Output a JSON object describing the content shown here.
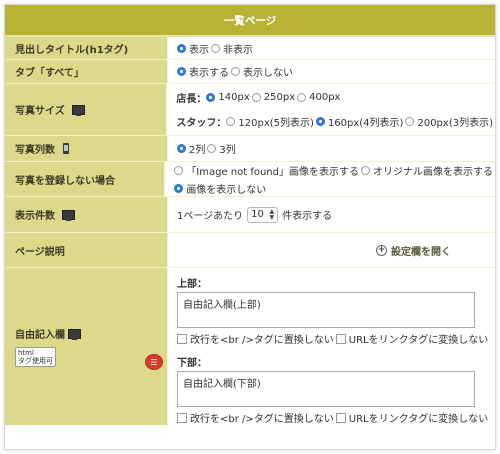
{
  "header": {
    "title": "一覧ページ"
  },
  "rows": {
    "heading_title": {
      "label": "見出しタイトル(h1タグ)",
      "options": [
        "表示",
        "非表示"
      ],
      "selected": "表示"
    },
    "tab_all": {
      "label": "タブ「すべて」",
      "options": [
        "表示する",
        "表示しない"
      ],
      "selected": "表示する"
    },
    "photo_size": {
      "label": "写真サイズ",
      "icon": "monitor-icon",
      "manager_label": "店長：",
      "manager_options": [
        "140px",
        "250px",
        "400px"
      ],
      "manager_selected": "140px",
      "staff_label": "スタッフ：",
      "staff_options": [
        "120px(5列表示)",
        "160px(4列表示)",
        "200px(3列表示)"
      ],
      "staff_selected": "160px(4列表示)"
    },
    "photo_columns": {
      "label": "写真列数",
      "icon": "smartphone-icon",
      "options": [
        "2列",
        "3列"
      ],
      "selected": "2列"
    },
    "no_photo": {
      "label": "写真を登録しない場合",
      "options": [
        "「Image not found」画像を表示する",
        "オリジナル画像を表示する",
        "画像を表示しない"
      ],
      "selected": "画像を表示しない"
    },
    "display_count": {
      "label": "表示件数",
      "icon": "monitor-icon",
      "prefix": "1ページあたり",
      "value": "10",
      "suffix": "件表示する"
    },
    "page_description": {
      "label": "ページ説明",
      "link": "設定欄を開く"
    },
    "free_text": {
      "label": "自由記入欄",
      "icon": "monitor-icon",
      "badge_line1": "html",
      "badge_line2": "タグ使用可",
      "top_label": "上部：",
      "top_value": "自由記入欄(上部)",
      "bottom_label": "下部：",
      "bottom_value": "自由記入欄(下部)",
      "check_br": "改行を<br />タグに置換しない",
      "check_url": "URLをリンクタグに変換しない"
    }
  },
  "colors": {
    "header": "#b9b335",
    "label_bg": "#dcd98a",
    "accent": "#2d7fe0",
    "bubble": "#d63b2c"
  }
}
